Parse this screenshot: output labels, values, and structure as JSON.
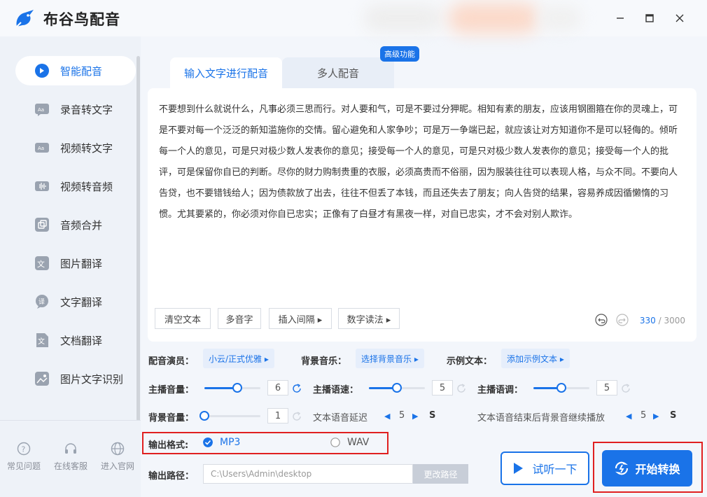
{
  "app": {
    "title": "布谷鸟配音"
  },
  "sidebar": {
    "items": [
      {
        "label": "智能配音"
      },
      {
        "label": "录音转文字"
      },
      {
        "label": "视频转文字"
      },
      {
        "label": "视频转音频"
      },
      {
        "label": "音频合并"
      },
      {
        "label": "图片翻译"
      },
      {
        "label": "文字翻译"
      },
      {
        "label": "文档翻译"
      },
      {
        "label": "图片文字识别"
      }
    ],
    "bottom": [
      {
        "label": "常见问题"
      },
      {
        "label": "在线客服"
      },
      {
        "label": "进入官网"
      }
    ]
  },
  "tabs": [
    {
      "label": "输入文字进行配音"
    },
    {
      "label": "多人配音"
    }
  ],
  "badge": "高级功能",
  "editor": {
    "text": " 不要想到什么就说什么，凡事必须三思而行。对人要和气，可是不要过分狎昵。相知有素的朋友，应该用钢圈箍在你的灵魂上，可是不要对每一个泛泛的新知滥施你的交情。留心避免和人家争吵；可是万一争端已起，就应该让对方知道你不是可以轻侮的。倾听每一个人的意见，可是只对极少数人发表你的意见；接受每一个人的意见，可是只对极少数人发表你的意见；接受每一个人的批评，可是保留你自已的判断。尽你的财力购制贵重的衣服，必须高贵而不俗丽，因为服装往往可以表现人格，与众不同。不要向人告贷，也不要错钱给人；因为债款放了出去，往往不但丢了本钱，而且还失去了朋友；向人告贷的结果，容易养成因循懒惰的习惯。尤其要紧的，你必须对你自已忠实；正像有了白昼才有黑夜一样，对自已忠实，才不会对别人欺诈。",
    "buttons": {
      "clear": "清空文本",
      "polyphone": "多音字",
      "pause": "插入间隔 ▸",
      "digits": "数字读法 ▸"
    },
    "count": "330",
    "max": "/ 3000"
  },
  "settings": {
    "voice_label": "配音演员：",
    "voice_value": "小云/正式优雅 ▸",
    "bgm_label": "背景音乐：",
    "bgm_value": "选择背景音乐 ▸",
    "sample_label": "示例文本：",
    "sample_value": "添加示例文本 ▸",
    "volume_label": "主播音量：",
    "volume_value": "6",
    "volume_level": 0.6,
    "speed_label": "主播语速：",
    "speed_value": "5",
    "speed_level": 0.5,
    "pitch_label": "主播语调：",
    "pitch_value": "5",
    "pitch_level": 0.5,
    "bg_volume_label": "背景音量：",
    "bg_volume_value": "1",
    "bg_volume_level": 0,
    "delay_label": "文本语音延迟",
    "delay_value": "5",
    "delay_unit": "S",
    "continue_label": "文本语音结束后背景音继续播放",
    "continue_value": "5",
    "continue_unit": "S",
    "format_label": "输出格式:",
    "format_mp3": "MP3",
    "format_wav": "WAV",
    "format_selected": "MP3",
    "path_label": "输出路径：",
    "path_value": "C:\\Users\\Admin\\desktop",
    "path_button": "更改路径"
  },
  "actions": {
    "listen": "试听一下",
    "start": "开始转换"
  },
  "colors": {
    "accent": "#1a73e8",
    "highlight": "#e02020"
  }
}
